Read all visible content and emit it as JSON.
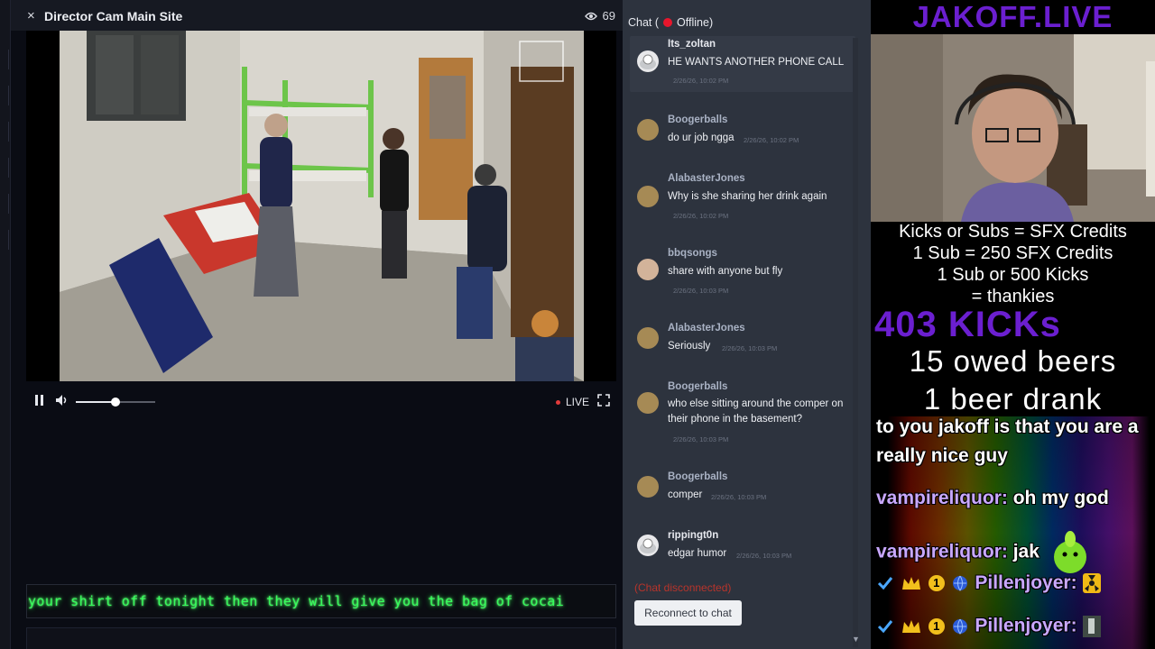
{
  "player": {
    "close_glyph": "×",
    "title": "Director Cam Main Site",
    "viewer_count": "69",
    "live_label": "LIVE",
    "volume_fraction": 0.5,
    "ticker_text": "your shirt off tonight then they will give you the bag of cocai"
  },
  "chat": {
    "header_prefix": "Chat (",
    "header_suffix": "Offline)",
    "messages": [
      {
        "user": "Its_zoltan",
        "text": "HE WANTS ANOTHER PHONE CALL",
        "time": "2/26/26, 10:02 PM"
      },
      {
        "user": "Boogerballs",
        "text": "do ur job ngga",
        "time": "2/26/26, 10:02 PM"
      },
      {
        "user": "AlabasterJones",
        "text": "Why is she sharing her drink again",
        "time": "2/26/26, 10:02 PM"
      },
      {
        "user": "bbqsongs",
        "text": "share with anyone but fly",
        "time": "2/26/26, 10:03 PM"
      },
      {
        "user": "AlabasterJones",
        "text": "Seriously",
        "time": "2/26/26, 10:03 PM"
      },
      {
        "user": "Boogerballs",
        "text": "who else sitting around the comper on their phone in the basement?",
        "time": "2/26/26, 10:03 PM"
      },
      {
        "user": "Boogerballs",
        "text": "comper",
        "time": "2/26/26, 10:03 PM"
      },
      {
        "user": "rippingt0n",
        "text": "edgar humor",
        "time": "2/26/26, 10:03 PM"
      }
    ],
    "disconnected_text": "(Chat disconnected)",
    "reconnect_label": "Reconnect to chat"
  },
  "stream": {
    "brand": "JAKOFF.LIVE",
    "rules": [
      "Kicks or Subs = SFX Credits",
      "1 Sub = 250 SFX Credits",
      "1 Sub or 500 Kicks",
      "= thankies"
    ],
    "kicks": "403 KICKs",
    "beers_owed": "15 owed beers",
    "beers_drank": "1 beer drank",
    "tts_text_1": "to you jakoff is that you are a",
    "tts_text_2": "really nice guy",
    "chat_lines": [
      {
        "user": "vampireliquor:",
        "text": "oh my god"
      },
      {
        "user": "vampireliquor:",
        "text": "jak"
      },
      {
        "user": "Pillenjoyer:",
        "text": ""
      },
      {
        "user": "Pillenjoyer:",
        "text": ""
      }
    ],
    "badge_number": "1"
  }
}
